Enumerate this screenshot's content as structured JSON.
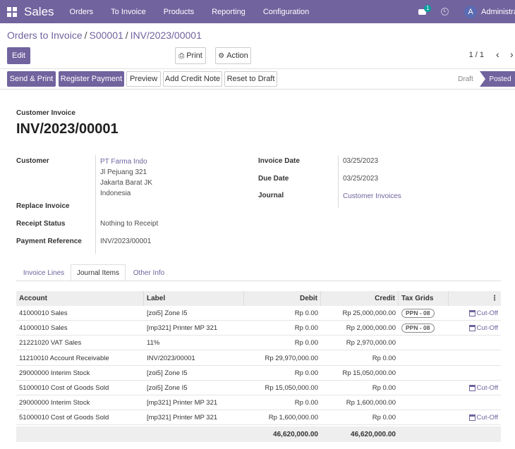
{
  "navbar": {
    "brand": "Sales",
    "menu": [
      "Orders",
      "To Invoice",
      "Products",
      "Reporting",
      "Configuration"
    ],
    "chat_badge": "1",
    "avatar_letter": "A",
    "username": "Administrator"
  },
  "breadcrumb": {
    "items": [
      "Orders to Invoice",
      "S00001"
    ],
    "current": "INV/2023/00001"
  },
  "buttons": {
    "edit": "Edit",
    "print": "Print",
    "action": "Action",
    "send_print": "Send & Print",
    "register_payment": "Register Payment",
    "preview": "Preview",
    "add_credit_note": "Add Credit Note",
    "reset_to_draft": "Reset to Draft"
  },
  "pager": {
    "value": "1 / 1"
  },
  "status": {
    "draft": "Draft",
    "posted": "Posted",
    "current": "Posted"
  },
  "invoice": {
    "type": "Customer Invoice",
    "number": "INV/2023/00001",
    "fields": {
      "customer_label": "Customer",
      "customer_name": "PT Farma Indo",
      "customer_address": [
        "Jl Pejuang 321",
        "Jakarta Barat JK",
        "Indonesia"
      ],
      "replace_invoice_label": "Replace Invoice",
      "receipt_status_label": "Receipt Status",
      "receipt_status": "Nothing to Receipt",
      "payment_reference_label": "Payment Reference",
      "payment_reference": "INV/2023/00001",
      "invoice_date_label": "Invoice Date",
      "invoice_date": "03/25/2023",
      "due_date_label": "Due Date",
      "due_date": "03/25/2023",
      "journal_label": "Journal",
      "journal": "Customer Invoices"
    }
  },
  "tabs": [
    "Invoice Lines",
    "Journal Items",
    "Other Info"
  ],
  "active_tab": "Journal Items",
  "journal_items": {
    "columns": [
      "Account",
      "Label",
      "Debit",
      "Credit",
      "Tax Grids"
    ],
    "rows": [
      {
        "account": "41000010 Sales",
        "label": "[zoi5] Zone I5",
        "debit": "Rp 0.00",
        "credit": "Rp 25,000,000.00",
        "tax": "PPN - 08",
        "cutoff": "Cut-Off"
      },
      {
        "account": "41000010 Sales",
        "label": "[mp321] Printer MP 321",
        "debit": "Rp 0.00",
        "credit": "Rp 2,000,000.00",
        "tax": "PPN - 08",
        "cutoff": "Cut-Off"
      },
      {
        "account": "21221020 VAT Sales",
        "label": "11%",
        "debit": "Rp 0.00",
        "credit": "Rp 2,970,000.00",
        "tax": "",
        "cutoff": ""
      },
      {
        "account": "11210010 Account Receivable",
        "label": "INV/2023/00001",
        "debit": "Rp 29,970,000.00",
        "credit": "Rp 0.00",
        "tax": "",
        "cutoff": ""
      },
      {
        "account": "29000000 Interim Stock",
        "label": "[zoi5] Zone I5",
        "debit": "Rp 0.00",
        "credit": "Rp 15,050,000.00",
        "tax": "",
        "cutoff": ""
      },
      {
        "account": "51000010 Cost of Goods Sold",
        "label": "[zoi5] Zone I5",
        "debit": "Rp 15,050,000.00",
        "credit": "Rp 0.00",
        "tax": "",
        "cutoff": "Cut-Off"
      },
      {
        "account": "29000000 Interim Stock",
        "label": "[mp321] Printer MP 321",
        "debit": "Rp 0.00",
        "credit": "Rp 1,600,000.00",
        "tax": "",
        "cutoff": ""
      },
      {
        "account": "51000010 Cost of Goods Sold",
        "label": "[mp321] Printer MP 321",
        "debit": "Rp 1,600,000.00",
        "credit": "Rp 0.00",
        "tax": "",
        "cutoff": "Cut-Off"
      }
    ],
    "totals": {
      "debit": "46,620,000.00",
      "credit": "46,620,000.00"
    }
  },
  "colors": {
    "brand": "#71639e",
    "badge": "#00a09d"
  }
}
